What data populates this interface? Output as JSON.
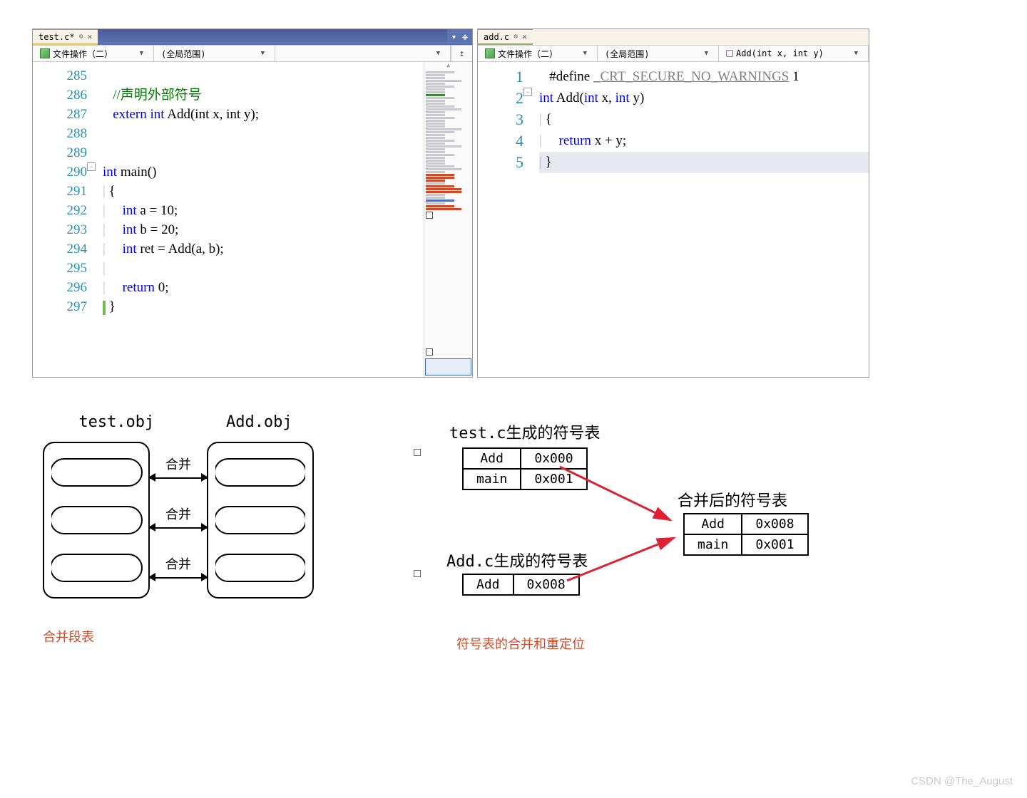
{
  "leftEditor": {
    "tab": "test.c*",
    "nav1": "文件操作（二）",
    "nav2": "(全局范围)",
    "lines": {
      "285": "",
      "286_comment": "//声明外部符号",
      "287_kw1": "extern",
      "287_kw2": "int",
      "287_rest": " Add(int x, int y);",
      "290_kw": "int",
      "290_rest": " main()",
      "291": "{",
      "292_kw": "int",
      "292_rest": " a = 10;",
      "293_kw": "int",
      "293_rest": " b = 20;",
      "294_kw": "int",
      "294_rest": " ret = Add(a, b);",
      "296_kw": "return",
      "296_rest": " 0;",
      "297": "}"
    },
    "lineNumbers": [
      "285",
      "286",
      "287",
      "288",
      "289",
      "290",
      "291",
      "292",
      "293",
      "294",
      "295",
      "296",
      "297"
    ]
  },
  "rightEditor": {
    "tab": "add.c",
    "nav1": "文件操作（二）",
    "nav2": "(全局范围)",
    "nav3": "Add(int x, int y)",
    "lineNumbers": [
      "1",
      "2",
      "3",
      "4",
      "5"
    ],
    "l1a": "#define ",
    "l1b": "_CRT_SECURE_NO_WARNINGS",
    "l1c": " 1",
    "l2a": "int",
    "l2b": " Add(",
    "l2c": "int",
    "l2d": " x, ",
    "l2e": "int",
    "l2f": " y)",
    "l3": "{",
    "l4a": "return",
    "l4b": " x + y;",
    "l5": "}"
  },
  "diagLeft": {
    "title1": "test.obj",
    "title2": "Add.obj",
    "merge": "合并",
    "caption": "合并段表"
  },
  "diagRight": {
    "title1": "test.c生成的符号表",
    "title2": "Add.c生成的符号表",
    "title3": "合并后的符号表",
    "t1": [
      [
        "Add",
        "0x000"
      ],
      [
        "main",
        "0x001"
      ]
    ],
    "t2": [
      [
        "Add",
        "0x008"
      ]
    ],
    "t3": [
      [
        "Add",
        "0x008"
      ],
      [
        "main",
        "0x001"
      ]
    ],
    "caption": "符号表的合并和重定位"
  },
  "watermark": "CSDN @The_August"
}
